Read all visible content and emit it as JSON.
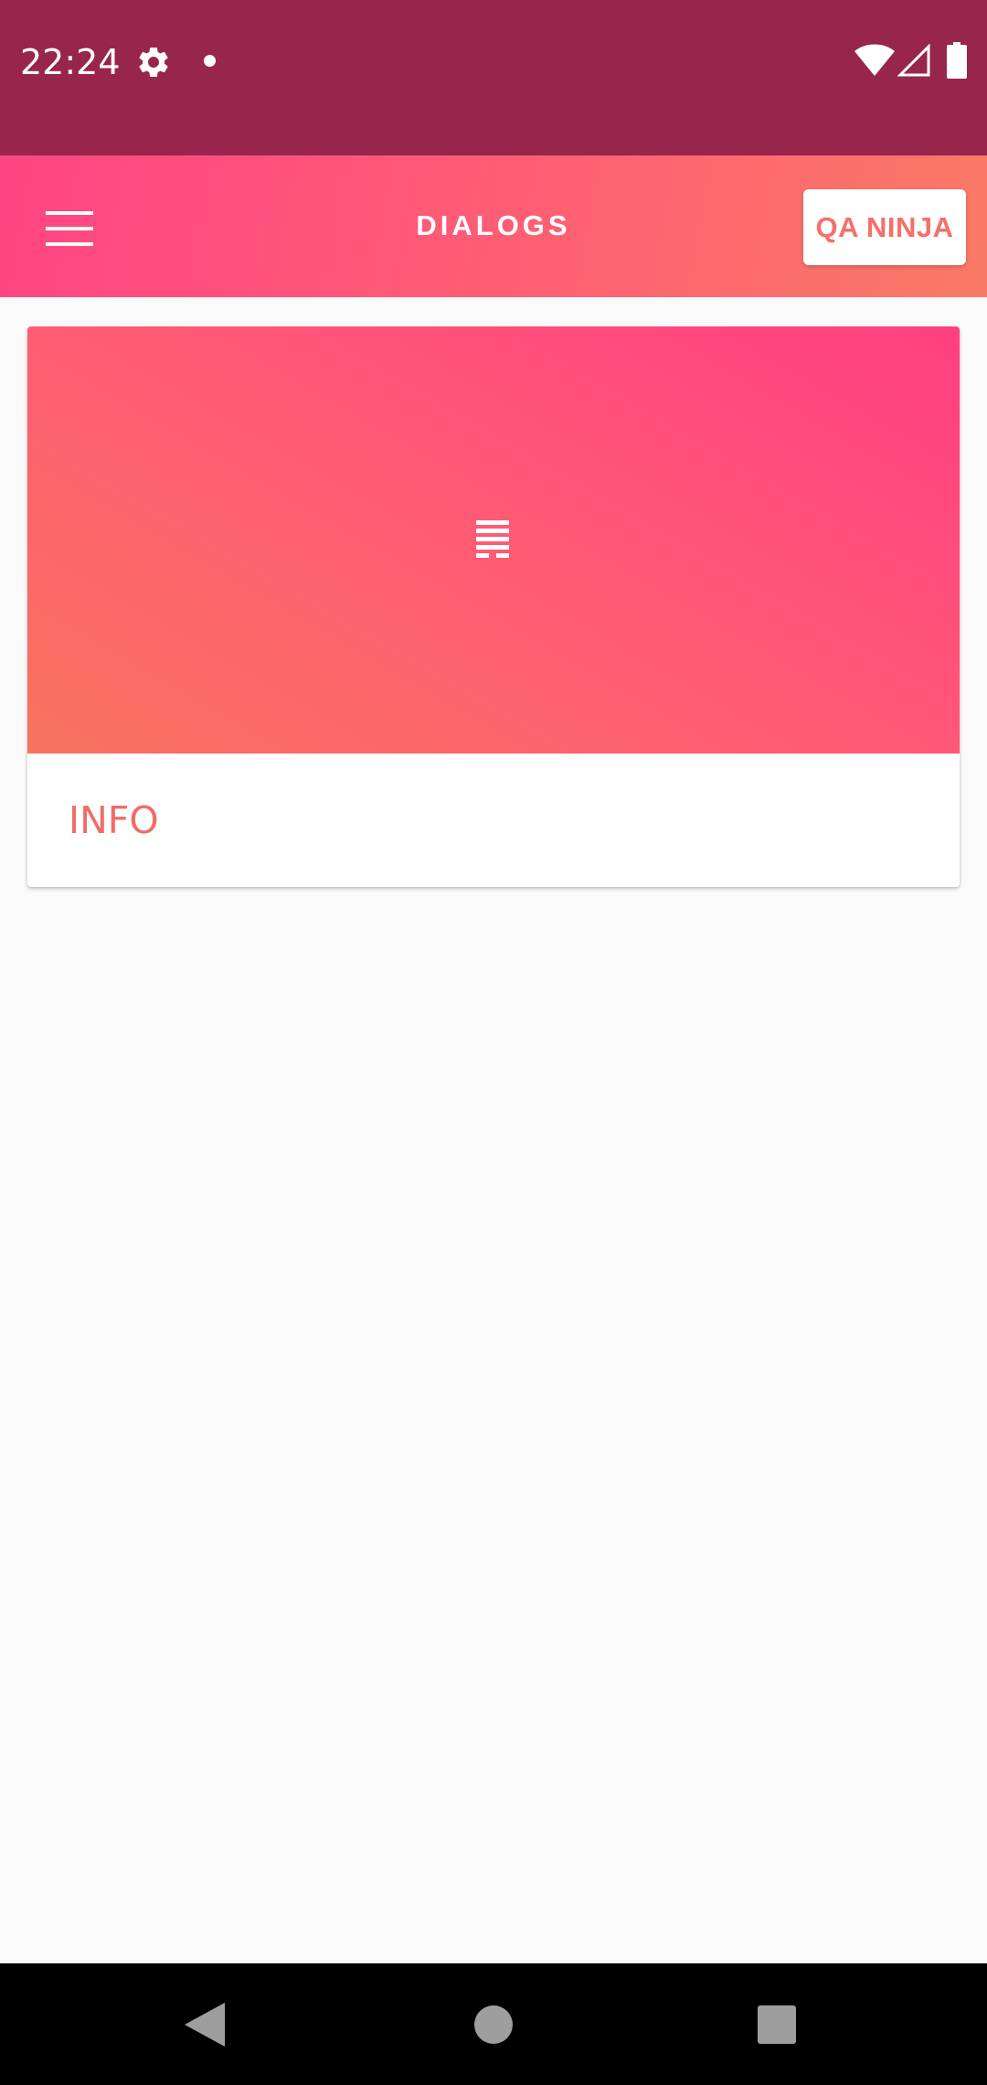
{
  "status_bar": {
    "time": "22:24",
    "icons": [
      "gear-icon",
      "dot-icon",
      "wifi-icon",
      "signal-icon",
      "battery-icon"
    ]
  },
  "app_bar": {
    "title": "DIALOGS",
    "menu_icon": "hamburger-menu-icon",
    "action_button_label": "QA NINJA",
    "gradient": [
      "#ff4584",
      "#f97a66"
    ]
  },
  "card": {
    "label": "INFO",
    "media_icon": "info-list-icon",
    "gradient": [
      "#ff3f81",
      "#f8735f"
    ]
  },
  "nav_bar": {
    "buttons": [
      "back-icon",
      "home-icon",
      "recents-icon"
    ]
  },
  "colors": {
    "status_bar": "#97254c",
    "accent_text": "#f36b66",
    "background": "#fafafa"
  }
}
